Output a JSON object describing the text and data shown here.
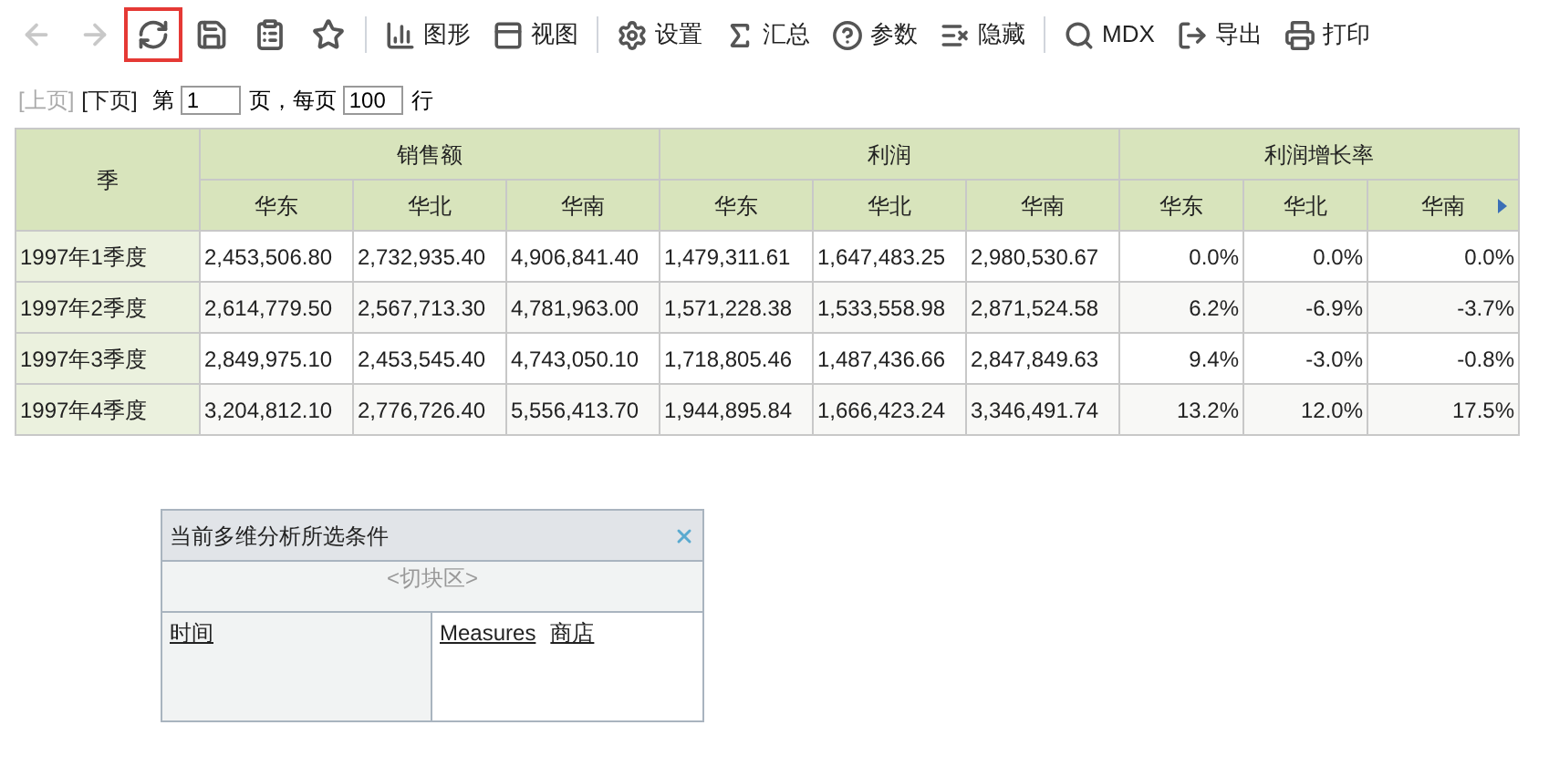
{
  "toolbar": [
    {
      "kind": "icon",
      "disabled": true,
      "selected": false
    },
    {
      "kind": "icon",
      "disabled": true,
      "selected": false
    },
    {
      "kind": "icon",
      "disabled": false,
      "selected": true
    },
    {
      "kind": "icon",
      "disabled": false,
      "selected": false
    },
    {
      "kind": "icon",
      "disabled": false,
      "selected": false
    },
    {
      "kind": "icon",
      "disabled": false,
      "selected": false
    },
    {
      "kind": "separator"
    },
    {
      "kind": "labeled",
      "label": "图形"
    },
    {
      "kind": "labeled",
      "label": "视图"
    },
    {
      "kind": "separator"
    },
    {
      "kind": "labeled",
      "label": "设置"
    },
    {
      "kind": "labeled",
      "label": "汇总"
    },
    {
      "kind": "labeled",
      "label": "参数"
    },
    {
      "kind": "labeled",
      "label": "隐藏"
    },
    {
      "kind": "separator"
    },
    {
      "kind": "labeled",
      "label": "MDX"
    },
    {
      "kind": "labeled",
      "label": "导出"
    },
    {
      "kind": "labeled",
      "label": "打印"
    }
  ],
  "pager": {
    "prev": {
      "label": "[上页]",
      "disabled": true
    },
    "next": {
      "label": "[下页]",
      "disabled": false
    },
    "page_prefix": "第",
    "page": "1",
    "page_suffix": "页，每页",
    "rows_per_page": "100",
    "rows_suffix": "行"
  },
  "table": {
    "row_header": "季",
    "groups": [
      {
        "label": "销售额",
        "columns": [
          "华东",
          "华北",
          "华南"
        ]
      },
      {
        "label": "利润",
        "columns": [
          "华东",
          "华北",
          "华南"
        ]
      },
      {
        "label": "利润增长率",
        "columns": [
          "华东",
          "华北",
          "华南"
        ]
      }
    ],
    "rows": [
      {
        "label": "1997年1季度",
        "cells": [
          "2,453,506.80",
          "2,732,935.40",
          "4,906,841.40",
          "1,479,311.61",
          "1,647,483.25",
          "2,980,530.67",
          "0.0%",
          "0.0%",
          "0.0%"
        ]
      },
      {
        "label": "1997年2季度",
        "cells": [
          "2,614,779.50",
          "2,567,713.30",
          "4,781,963.00",
          "1,571,228.38",
          "1,533,558.98",
          "2,871,524.58",
          "6.2%",
          "-6.9%",
          "-3.7%"
        ]
      },
      {
        "label": "1997年3季度",
        "cells": [
          "2,849,975.10",
          "2,453,545.40",
          "4,743,050.10",
          "1,718,805.46",
          "1,487,436.66",
          "2,847,849.63",
          "9.4%",
          "-3.0%",
          "-0.8%"
        ]
      },
      {
        "label": "1997年4季度",
        "cells": [
          "3,204,812.10",
          "2,776,726.40",
          "5,556,413.70",
          "1,944,895.84",
          "1,666,423.24",
          "3,346,491.74",
          "13.2%",
          "12.0%",
          "17.5%"
        ]
      }
    ]
  },
  "panel": {
    "title": "当前多维分析所选条件",
    "slicer": "<切块区>",
    "rows_fields": [
      "时间"
    ],
    "columns_fields": [
      "Measures",
      "商店"
    ]
  }
}
